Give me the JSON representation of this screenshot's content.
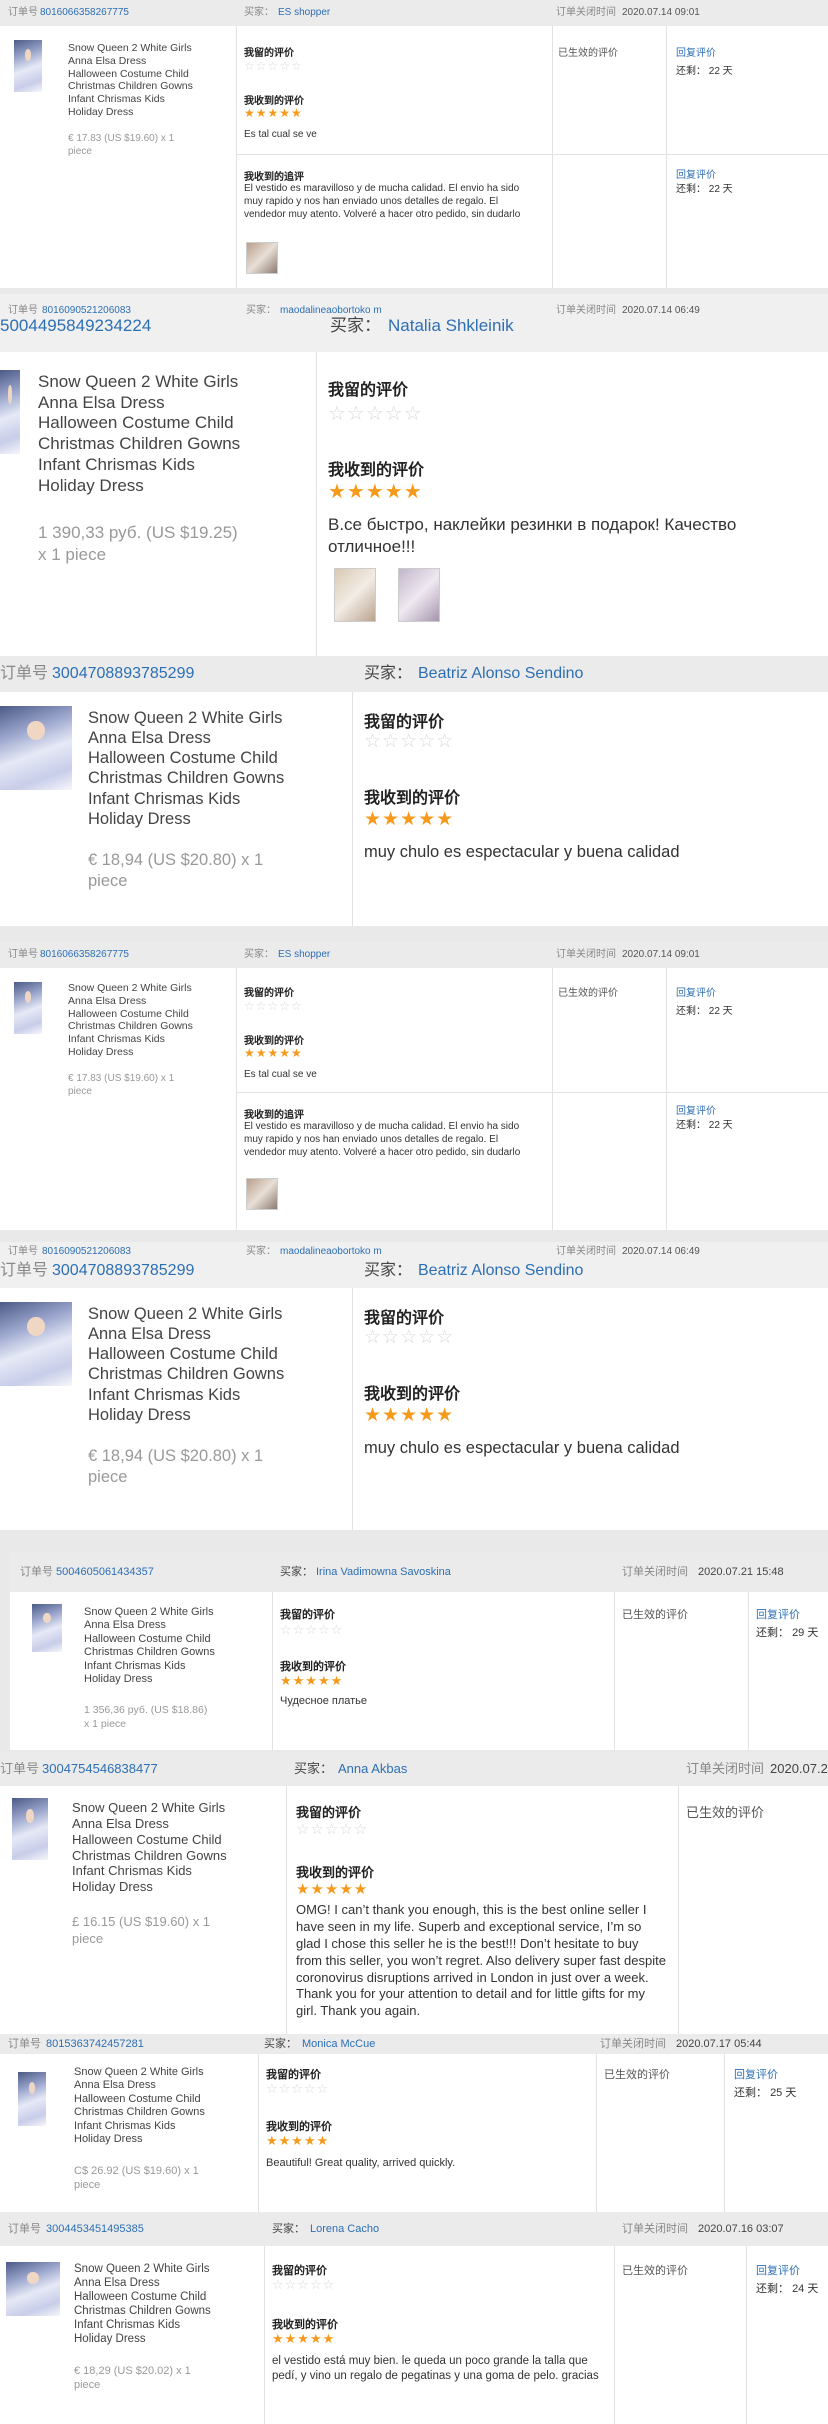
{
  "labels": {
    "order_no": "订单号",
    "buyer": "买家：",
    "close_time": "订单关闭时间",
    "my_review": "我留的评价",
    "received_review": "我收到的评价",
    "received_followup": "我收到的追评",
    "effective_review": "已生效的评价",
    "reply_review": "回复评价",
    "remaining": "还剩："
  },
  "product": {
    "title_lines": [
      "Snow Queen 2 White Girls",
      "Anna Elsa Dress",
      "Halloween Costume Child",
      "Christmas Children Gowns",
      "Infant Chrismas Kids",
      "Holiday Dress"
    ]
  },
  "orders": [
    {
      "order_id": "8016066358267775",
      "buyer": "ES shopper",
      "close_time": "2020.07.14 09:01",
      "price_lines": [
        "€ 17.83 (US $19.60) x 1",
        "piece"
      ],
      "my_stars": 0,
      "received_stars": 5,
      "review_text": "Es tal cual se ve",
      "followup_text": "El vestido es maravilloso y de mucha calidad. El envio ha sido muy rapido y nos han enviado unos detalles de regalo. El vendedor muy atento. Volveré a hacer otro pedido, sin dudarlo",
      "status": "已生效的评价",
      "reply": "回复评价",
      "days_left": "22 天",
      "followup_reply": "回复评价",
      "followup_days": "22 天"
    },
    {
      "order_id": "8016090521206083",
      "buyer": "maodalineaobortoko m",
      "close_time": "2020.07.14 06:49"
    },
    {
      "order_id": "5004495849234224",
      "buyer": "Natalia Shkleinik",
      "price_lines": [
        "1 390,33 руб. (US $19.25)",
        "x 1 piece"
      ],
      "my_stars": 0,
      "received_stars": 5,
      "review_text": "В.се быстро, наклейки резинки в подарок! Качество отличное!!!"
    },
    {
      "order_id": "3004708893785299",
      "buyer": "Beatriz Alonso Sendino",
      "price_lines": [
        "€ 18,94 (US $20.80) x 1",
        "piece"
      ],
      "my_stars": 0,
      "received_stars": 5,
      "review_text": "muy chulo es espectacular y buena calidad"
    },
    {
      "order_id": "5004605061434357",
      "buyer": "Irina Vadimowna Savoskina",
      "close_time": "2020.07.21 15:48",
      "price_lines": [
        "1 356,36 руб. (US $18.86)",
        "x 1 piece"
      ],
      "my_stars": 0,
      "received_stars": 5,
      "review_text": "Чудесное платье",
      "status": "已生效的评价",
      "reply": "回复评价",
      "days_left": "29 天"
    },
    {
      "order_id": "3004754546838477",
      "buyer": "Anna Akbas",
      "close_time": "2020.07.2",
      "price_lines": [
        "£ 16.15 (US $19.60) x 1",
        "piece"
      ],
      "my_stars": 0,
      "received_stars": 5,
      "review_text": "OMG! I can’t thank you enough, this is the best online seller I have seen in my life. Superb and exceptional service, I’m so glad I chose this seller he is the best!!! Don’t hesitate to buy from this seller, you won’t regret. Also delivery super fast despite coronovirus disruptions arrived in London in just over a week. Thank you for your attention to detail and for little gifts for my girl. Thank you again.",
      "status": "已生效的评价"
    },
    {
      "order_id": "8015363742457281",
      "buyer": "Monica McCue",
      "close_time": "2020.07.17 05:44",
      "price_lines": [
        "C$ 26.92 (US $19.60) x 1",
        "piece"
      ],
      "my_stars": 0,
      "received_stars": 5,
      "review_text": "Beautiful! Great quality, arrived quickly.",
      "status": "已生效的评价",
      "reply": "回复评价",
      "days_left": "25 天"
    },
    {
      "order_id": "3004453451495385",
      "buyer": "Lorena Cacho",
      "close_time": "2020.07.16 03:07",
      "price_lines": [
        "€ 18,29 (US $20.02) x 1",
        "piece"
      ],
      "my_stars": 0,
      "received_stars": 5,
      "review_text": "el vestido está muy bien. le queda un poco grande la talla que pedí, y vino un regalo de pegatinas y una goma de pelo. gracias",
      "status": "已生效的评价",
      "reply": "回复评价",
      "days_left": "24 天"
    }
  ],
  "stars": {
    "empty": "☆☆☆☆☆",
    "full": "★★★★★"
  }
}
